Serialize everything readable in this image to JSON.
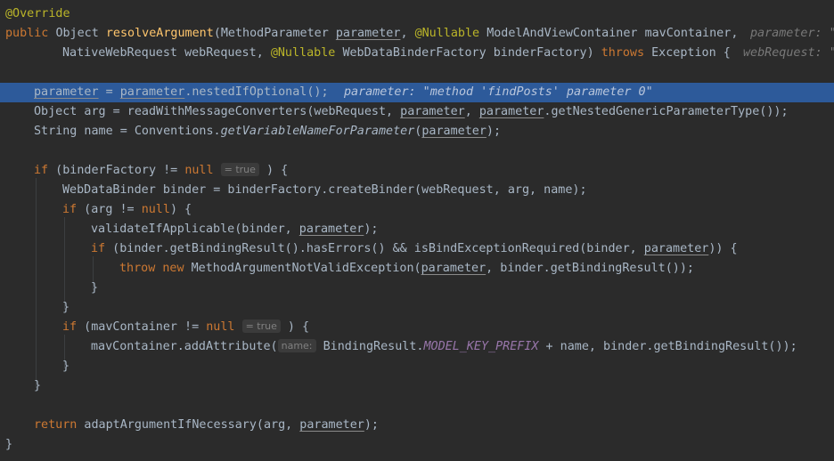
{
  "editor": {
    "theme_background": "#2b2b2b",
    "highlight_color": "#2d5a9a",
    "lines": {
      "l1": {
        "annotation": "@Override"
      },
      "l2": {
        "kw_public": "public",
        "type_object": "Object",
        "method_name": "resolveArgument",
        "open_paren": "(",
        "type_mp": "MethodParameter",
        "param_parameter": "parameter",
        "comma1": ",",
        "ann_nullable1": "@Nullable",
        "type_mavc": "ModelAndViewContainer",
        "param_mav": "mavContainer",
        "comma2": ",",
        "hint": "parameter: \""
      },
      "l3": {
        "type_nwr": "NativeWebRequest",
        "param_wr": "webRequest",
        "comma": ",",
        "ann_nullable2": "@Nullable",
        "type_wdbf": "WebDataBinderFactory",
        "param_bf": "binderFactory",
        "close": ")",
        "kw_throws": "throws",
        "type_exc": "Exception",
        "brace": "{",
        "hint": "webRequest: \""
      },
      "l5": {
        "lhs": "parameter",
        "eq": " = ",
        "rhs": "parameter",
        "call": ".nestedIfOptional();",
        "hint": "parameter: \"method 'findPosts' parameter 0\""
      },
      "l6": {
        "text1": "Object arg = readWithMessageConverters(webRequest, ",
        "p1": "parameter",
        "text2": ", ",
        "p2": "parameter",
        "text3": ".getNestedGenericParameterType());"
      },
      "l7": {
        "text1": "String name = Conventions.",
        "method": "getVariableNameForParameter",
        "text2": "(",
        "p": "parameter",
        "text3": ");"
      },
      "l9": {
        "kw_if": "if",
        "text1": " (binderFactory != ",
        "kw_null": "null",
        "chip": "= true",
        "text2": " ) {"
      },
      "l10": {
        "text": "WebDataBinder binder = binderFactory.createBinder(webRequest, arg, name);"
      },
      "l11": {
        "kw_if": "if",
        "text1": " (arg != ",
        "kw_null": "null",
        "text2": ") {"
      },
      "l12": {
        "text1": "validateIfApplicable(binder, ",
        "p": "parameter",
        "text2": ");"
      },
      "l13": {
        "kw_if": "if",
        "text1": " (binder.getBindingResult().hasErrors() && isBindExceptionRequired(binder, ",
        "p": "parameter",
        "text2": ")) {"
      },
      "l14": {
        "kw_throw": "throw",
        "kw_new": "new",
        "text1": " MethodArgumentNotValidException(",
        "p": "parameter",
        "text2": ", binder.getBindingResult());"
      },
      "l15": {
        "text": "}"
      },
      "l16": {
        "text": "}"
      },
      "l17": {
        "kw_if": "if",
        "text1": " (mavContainer != ",
        "kw_null": "null",
        "chip": "= true",
        "text2": " ) {"
      },
      "l18": {
        "text1": "mavContainer.addAttribute(",
        "chip": "name:",
        "text2": " BindingResult.",
        "const": "MODEL_KEY_PREFIX",
        "text3": " + name, binder.getBindingResult());"
      },
      "l19": {
        "text": "}"
      },
      "l20": {
        "text": "}"
      },
      "l22": {
        "kw_return": "return",
        "text1": " adaptArgumentIfNecessary(arg, ",
        "p": "parameter",
        "text2": ");"
      },
      "l23": {
        "text": "}"
      }
    }
  }
}
